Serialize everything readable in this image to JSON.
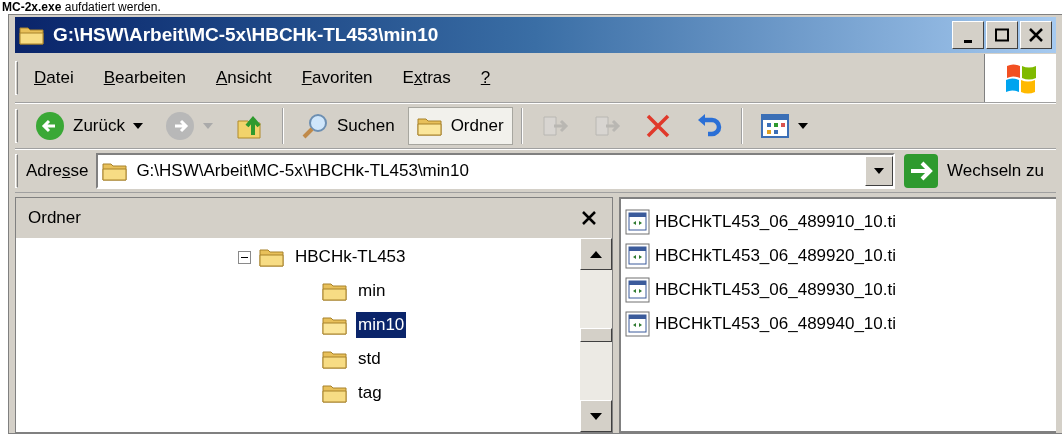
{
  "caption": "**MC-2x.exe** aufdatiert werden.",
  "window": {
    "title": "G:\\HSW\\Arbeit\\MC-5x\\HBCHk-TL453\\min10"
  },
  "menu": [
    {
      "key": "D",
      "post": "atei"
    },
    {
      "key": "B",
      "post": "earbeiten"
    },
    {
      "key": "A",
      "post": "nsicht"
    },
    {
      "key": "F",
      "post": "avoriten"
    },
    {
      "pre": "E",
      "key": "x",
      "post": "tras"
    },
    {
      "key": "?"
    }
  ],
  "toolbar": [
    {
      "kind": "back",
      "label": "Zurück",
      "disabled": false,
      "dropdown": true
    },
    {
      "kind": "forward",
      "disabled": true,
      "dropdown": true
    },
    {
      "kind": "up",
      "disabled": false
    },
    {
      "kind": "separator"
    },
    {
      "kind": "search",
      "label": "Suchen",
      "selected": false
    },
    {
      "kind": "folders",
      "label": "Ordner",
      "selected": true
    },
    {
      "kind": "separator"
    },
    {
      "kind": "move",
      "disabled": true
    },
    {
      "kind": "copy",
      "disabled": true
    },
    {
      "kind": "delete",
      "disabled": false
    },
    {
      "kind": "undo",
      "disabled": false
    },
    {
      "kind": "separator"
    },
    {
      "kind": "views",
      "disabled": false,
      "dropdown": true
    }
  ],
  "address": {
    "label": {
      "pre": "Adre",
      "key": "s",
      "post": "se"
    },
    "value": "G:\\HSW\\Arbeit\\MC-5x\\HBCHk-TL453\\min10",
    "go_label": "Wechseln zu"
  },
  "folders_pane": {
    "title": "Ordner",
    "tree": [
      {
        "label": "HBCHk-TL453",
        "expanded": true,
        "selected": false,
        "children": [
          {
            "label": "min",
            "selected": false
          },
          {
            "label": "min10",
            "selected": true
          },
          {
            "label": "std",
            "selected": false
          },
          {
            "label": "tag",
            "selected": false
          }
        ]
      }
    ]
  },
  "files": [
    {
      "name": "HBCHkTL453_06_489910_10.ti"
    },
    {
      "name": "HBCHkTL453_06_489920_10.ti"
    },
    {
      "name": "HBCHkTL453_06_489930_10.ti"
    },
    {
      "name": "HBCHkTL453_06_489940_10.ti"
    }
  ]
}
